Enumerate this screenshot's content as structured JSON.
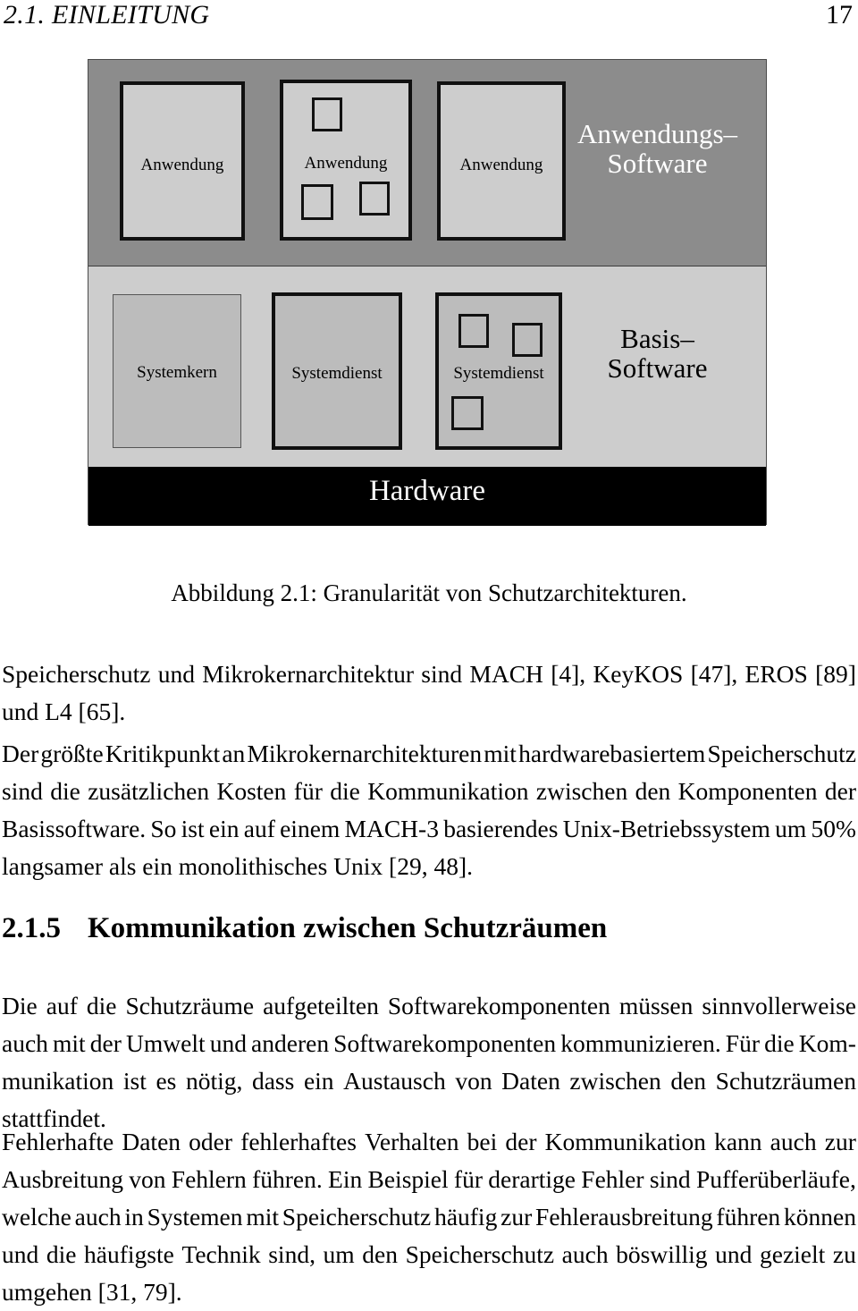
{
  "header": {
    "section_title": "2.1. EINLEITUNG",
    "page_number": "17"
  },
  "figure": {
    "caption": "Abbildung 2.1: Granularität von Schutzarchitekturen.",
    "bands": [
      {
        "id": "application-layer",
        "label": "Anwendungs–\nSoftware",
        "label_line1": "Anwendungs–",
        "label_line2": "Software",
        "background": "#8c8c8c",
        "text_color": "#ffffff",
        "components": [
          {
            "label": "Anwendung",
            "border": "thick",
            "subboxes": 0
          },
          {
            "label": "Anwendung",
            "border": "thick",
            "subboxes": 3
          },
          {
            "label": "Anwendung",
            "border": "thick",
            "subboxes": 0
          }
        ]
      },
      {
        "id": "base-software-layer",
        "label": "Basis–\nSoftware",
        "label_line1": "Basis–",
        "label_line2": "Software",
        "background": "#cdcdcd",
        "text_color": "#000000",
        "components": [
          {
            "label": "Systemkern",
            "border": "thin",
            "subboxes": 0
          },
          {
            "label": "Systemdienst",
            "border": "thick",
            "subboxes": 0
          },
          {
            "label": "Systemdienst",
            "border": "thick",
            "subboxes": 3
          }
        ]
      },
      {
        "id": "hardware-layer",
        "label": "Hardware",
        "background": "#000000",
        "text_color": "#ffffff",
        "components": []
      }
    ]
  },
  "body": {
    "paragraph1": {
      "lines": [
        "Speicherschutz und Mikrokernarchitektur sind MACH [4], KeyKOS [47], EROS [89]",
        "und L4 [65]."
      ]
    },
    "paragraph2": {
      "lines": [
        "Der größte Kritikpunkt an Mikrokernarchitekturen mit hardwarebasiertem Speicherschutz",
        "sind die zusätzlichen Kosten für die Kommunikation zwischen den Komponenten der",
        "Basissoftware. So ist ein auf einem MACH-3 basierendes Unix-Betriebssystem um 50%",
        "langsamer als ein monolithisches Unix [29, 48]."
      ]
    },
    "section": {
      "number": "2.1.5",
      "title": "Kommunikation zwischen Schutzräumen"
    },
    "paragraph3": {
      "lines": [
        "Die auf die Schutzräume aufgeteilten Softwarekomponenten müssen sinnvollerweise",
        "auch mit der Umwelt und anderen Softwarekomponenten kommunizieren. Für die Kom-",
        "munikation ist es nötig, dass ein Austausch von Daten zwischen den Schutzräumen",
        "stattfindet."
      ]
    },
    "paragraph4": {
      "lines": [
        "Fehlerhafte Daten oder fehlerhaftes Verhalten bei der Kommunikation kann auch zur",
        "Ausbreitung von Fehlern führen. Ein Beispiel für derartige Fehler sind Pufferüberläufe,",
        "welche auch in Systemen mit Speicherschutz häufig zur Fehlerausbreitung führen können",
        "und die häufigste Technik sind, um den Speicherschutz auch böswillig und gezielt zu",
        "umgehen [31, 79]."
      ]
    }
  }
}
